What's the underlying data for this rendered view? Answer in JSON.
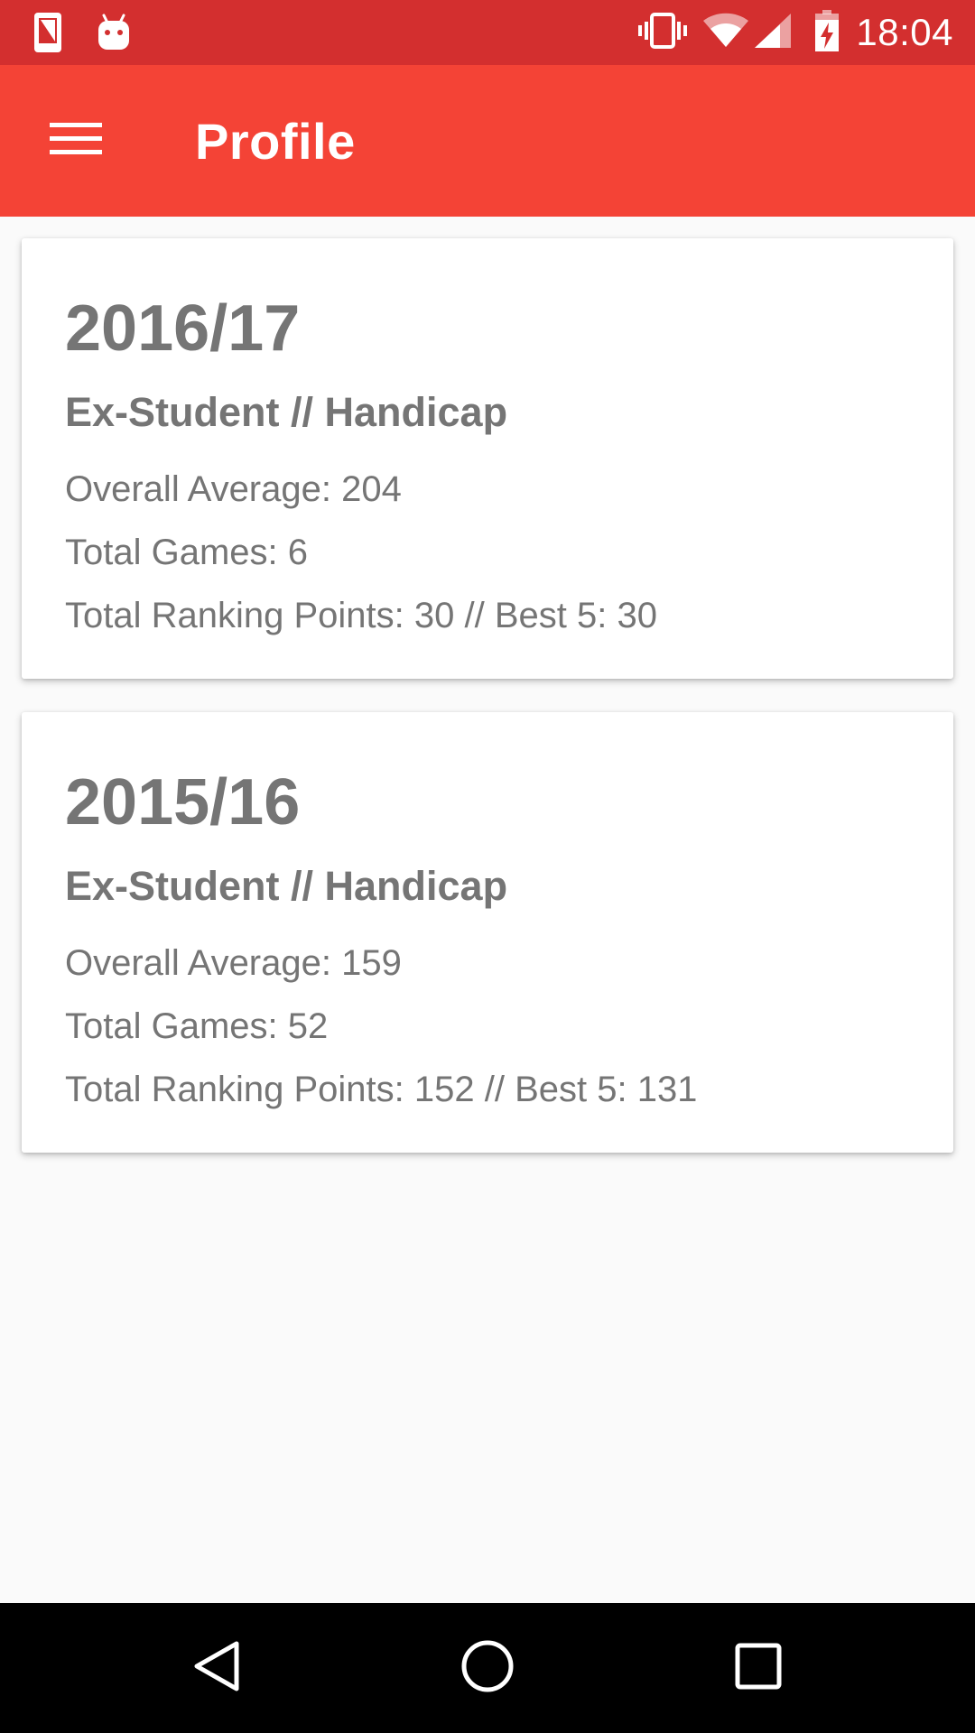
{
  "status_bar": {
    "time": "18:04",
    "background": "#D32F2F",
    "icons": [
      "sim-card-icon",
      "android-icon",
      "vibrate-icon",
      "wifi-icon",
      "signal-icon",
      "battery-charging-icon"
    ]
  },
  "toolbar": {
    "title": "Profile",
    "background": "#F44336",
    "menu_icon": "hamburger-menu-icon"
  },
  "seasons": [
    {
      "season": "2016/17",
      "category": "Ex-Student // Handicap",
      "overall_average": "Overall Average: 204",
      "total_games": "Total Games: 6",
      "ranking_points": "Total Ranking Points: 30 // Best 5: 30"
    },
    {
      "season": "2015/16",
      "category": "Ex-Student // Handicap",
      "overall_average": "Overall Average: 159",
      "total_games": "Total Games: 52",
      "ranking_points": "Total Ranking Points: 152 // Best 5: 131"
    }
  ],
  "nav_bar": {
    "buttons": [
      "back-icon",
      "home-icon",
      "recents-icon"
    ]
  }
}
